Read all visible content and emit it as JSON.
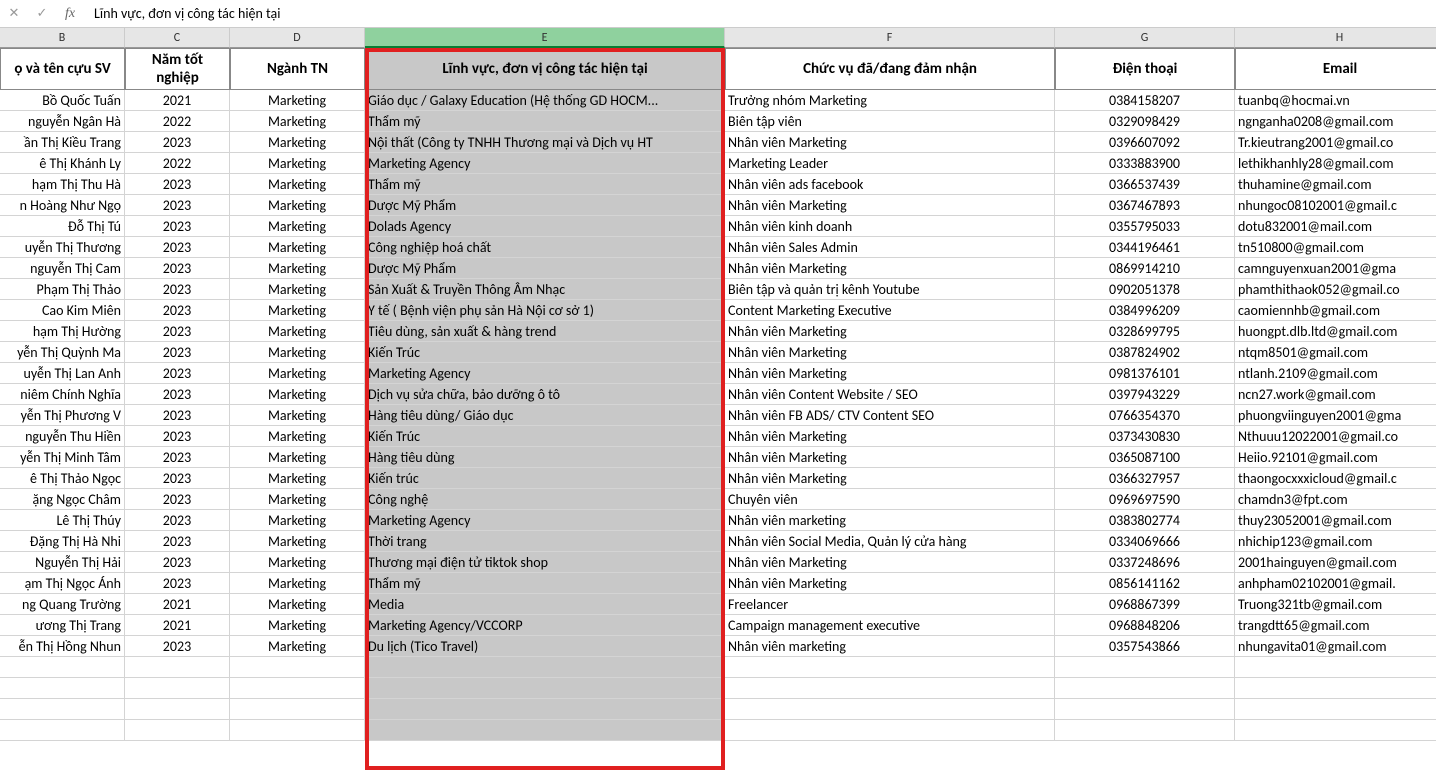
{
  "formula_bar": {
    "cancel": "✕",
    "accept": "✓",
    "fx": "fx",
    "value": "Lĩnh vực, đơn vị công tác hiện tại"
  },
  "columns": [
    "B",
    "C",
    "D",
    "E",
    "F",
    "G",
    "H"
  ],
  "selected_column": "E",
  "headers": {
    "B": "ọ và tên cựu SV",
    "C": "Năm tốt nghiệp",
    "D": "Ngành TN",
    "E": "Lĩnh vực, đơn vị công tác hiện tại",
    "F": "Chức vụ đã/đang đảm nhận",
    "G": "Điện thoại",
    "H": "Email"
  },
  "rows": [
    {
      "B": "Bồ Quốc Tuấn",
      "C": "2021",
      "D": "Marketing",
      "E": "Giáo dục / Galaxy Education (Hệ thống GD HOCM...",
      "F": "Trưởng nhóm Marketing",
      "G": "0384158207",
      "H": "tuanbq@hocmai.vn"
    },
    {
      "B": "nguyễn Ngân Hà",
      "C": "2022",
      "D": "Marketing",
      "E": "Thẩm mỹ",
      "F": "Biên tập viên",
      "G": "0329098429",
      "H": "ngnganha0208@gmail.com"
    },
    {
      "B": "ần Thị Kiều Trang",
      "C": "2023",
      "D": "Marketing",
      "E": "Nội thất (Công ty TNHH Thương mại và Dịch vụ HT",
      "F": "Nhân viên Marketing",
      "G": "0396607092",
      "H": "Tr.kieutrang2001@gmail.co"
    },
    {
      "B": "ê Thị Khánh Ly",
      "C": "2022",
      "D": "Marketing",
      "E": "Marketing Agency",
      "F": "Marketing Leader",
      "G": "0333883900",
      "H": "lethikhanhly28@gmail.com"
    },
    {
      "B": "hạm Thị Thu Hà",
      "C": "2023",
      "D": "Marketing",
      "E": "Thẩm mỹ",
      "F": "Nhân viên ads facebook",
      "G": "0366537439",
      "H": "thuhamine@gmail.com"
    },
    {
      "B": "n Hoàng Như Ngọ",
      "C": "2023",
      "D": "Marketing",
      "E": "Dược Mỹ Phẩm",
      "F": "Nhân viên Marketing",
      "G": "0367467893",
      "H": "nhungoc08102001@gmail.c"
    },
    {
      "B": "Đỗ Thị Tú",
      "C": "2023",
      "D": "Marketing",
      "E": "Dolads Agency",
      "F": "Nhân viên kinh doanh",
      "G": "0355795033",
      "H": "dotu832001@mail.com"
    },
    {
      "B": "uyễn Thị Thương",
      "C": "2023",
      "D": "Marketing",
      "E": "Công nghiệp hoá chất",
      "F": "Nhân viên Sales Admin",
      "G": "0344196461",
      "H": "tn510800@gmail.com"
    },
    {
      "B": "nguyễn Thị Cam",
      "C": "2023",
      "D": "Marketing",
      "E": "Dược Mỹ Phẩm",
      "F": "Nhân viên Marketing",
      "G": "0869914210",
      "H": "camnguyenxuan2001@gma"
    },
    {
      "B": "Phạm Thị Thảo",
      "C": "2023",
      "D": "Marketing",
      "E": "Sản Xuất & Truyền Thông Âm Nhạc",
      "F": "Biên tập và quản trị kênh Youtube",
      "G": "0902051378",
      "H": "phamthithaok052@gmail.co"
    },
    {
      "B": "Cao Kim Miên",
      "C": "2023",
      "D": "Marketing",
      "E": "Y tế ( Bệnh viện phụ sản Hà Nội cơ sở 1)",
      "F": "Content Marketing Executive",
      "G": "0384996209",
      "H": "caomiennhb@gmail.com"
    },
    {
      "B": "hạm Thị Hường",
      "C": "2023",
      "D": "Marketing",
      "E": "Tiêu dùng, sản xuất & hàng trend",
      "F": "Nhân viên Marketing",
      "G": "0328699795",
      "H": "huongpt.dlb.ltd@gmail.com"
    },
    {
      "B": "yễn Thị Quỳnh Ma",
      "C": "2023",
      "D": "Marketing",
      "E": "Kiến Trúc",
      "F": "Nhân viên Marketing",
      "G": "0387824902",
      "H": "ntqm8501@gmail.com"
    },
    {
      "B": "uyễn Thị Lan Anh",
      "C": "2023",
      "D": "Marketing",
      "E": "Marketing Agency",
      "F": "Nhân viên Marketing",
      "G": "0981376101",
      "H": "ntlanh.2109@gmail.com"
    },
    {
      "B": "niêm Chính Nghĩa",
      "C": "2023",
      "D": "Marketing",
      "E": "Dịch vụ sửa chữa, bảo dưỡng ô tô",
      "F": "Nhân viên Content Website / SEO",
      "G": "0397943229",
      "H": "ncn27.work@gmail.com"
    },
    {
      "B": "yễn Thị Phương V",
      "C": "2023",
      "D": "Marketing",
      "E": "Hàng tiêu dùng/ Giáo dục",
      "F": "Nhân viên FB ADS/ CTV Content SEO",
      "G": "0766354370",
      "H": "phuongviinguyen2001@gma"
    },
    {
      "B": "nguyễn Thu Hiền",
      "C": "2023",
      "D": "Marketing",
      "E": "Kiến Trúc",
      "F": "Nhân viên Marketing",
      "G": "0373430830",
      "H": "Nthuuu12022001@gmail.co"
    },
    {
      "B": "yễn Thị Minh Tâm",
      "C": "2023",
      "D": "Marketing",
      "E": "Hàng tiêu dùng",
      "F": "Nhân viên Marketing",
      "G": "0365087100",
      "H": "Heiio.92101@gmail.com"
    },
    {
      "B": "ê Thị Thảo Ngọc",
      "C": "2023",
      "D": "Marketing",
      "E": "Kiến trúc",
      "F": "Nhân viên Marketing",
      "G": "0366327957",
      "H": "thaongocxxxicloud@gmail.c"
    },
    {
      "B": "ặng Ngọc Châm",
      "C": "2023",
      "D": "Marketing",
      "E": "Công nghệ",
      "F": "Chuyên viên",
      "G": "0969697590",
      "H": "chamdn3@fpt.com"
    },
    {
      "B": "Lê Thị Thúy",
      "C": "2023",
      "D": "Marketing",
      "E": "Marketing Agency",
      "F": "Nhân viên marketing",
      "G": "0383802774",
      "H": "thuy23052001@gmail.com"
    },
    {
      "B": "Đặng Thị Hà Nhi",
      "C": "2023",
      "D": "Marketing",
      "E": "Thời trang",
      "F": "Nhân viên Social Media, Quản lý cửa hàng",
      "G": "0334069666",
      "H": "nhichip123@gmail.com"
    },
    {
      "B": "Nguyễn Thị Hải",
      "C": "2023",
      "D": "Marketing",
      "E": "Thương mại điện tử tiktok shop",
      "F": "Nhân viên Marketing",
      "G": "0337248696",
      "H": "2001hainguyen@gmail.com"
    },
    {
      "B": "ạm Thị Ngọc Ánh",
      "C": "2023",
      "D": "Marketing",
      "E": "Thẩm mỹ",
      "F": "Nhân viên Marketing",
      "G": "0856141162",
      "H": "anhpham02102001@gmail."
    },
    {
      "B": "ng Quang Trường",
      "C": "2021",
      "D": "Marketing",
      "E": "Media",
      "F": "Freelancer",
      "G": "0968867399",
      "H": "Truong321tb@gmail.com"
    },
    {
      "B": "ương Thị Trang",
      "C": "2021",
      "D": "Marketing",
      "E": "Marketing Agency/VCCORP",
      "F": "Campaign management executive",
      "G": "0968848206",
      "H": "trangdtt65@gmail.com"
    },
    {
      "B": "ễn Thị Hồng Nhun",
      "C": "2023",
      "D": "Marketing",
      "E": "Du lịch (Tico Travel)",
      "F": "Nhân viên marketing",
      "G": "0357543866",
      "H": "nhungavita01@gmail.com"
    }
  ],
  "empty_rows": 4
}
